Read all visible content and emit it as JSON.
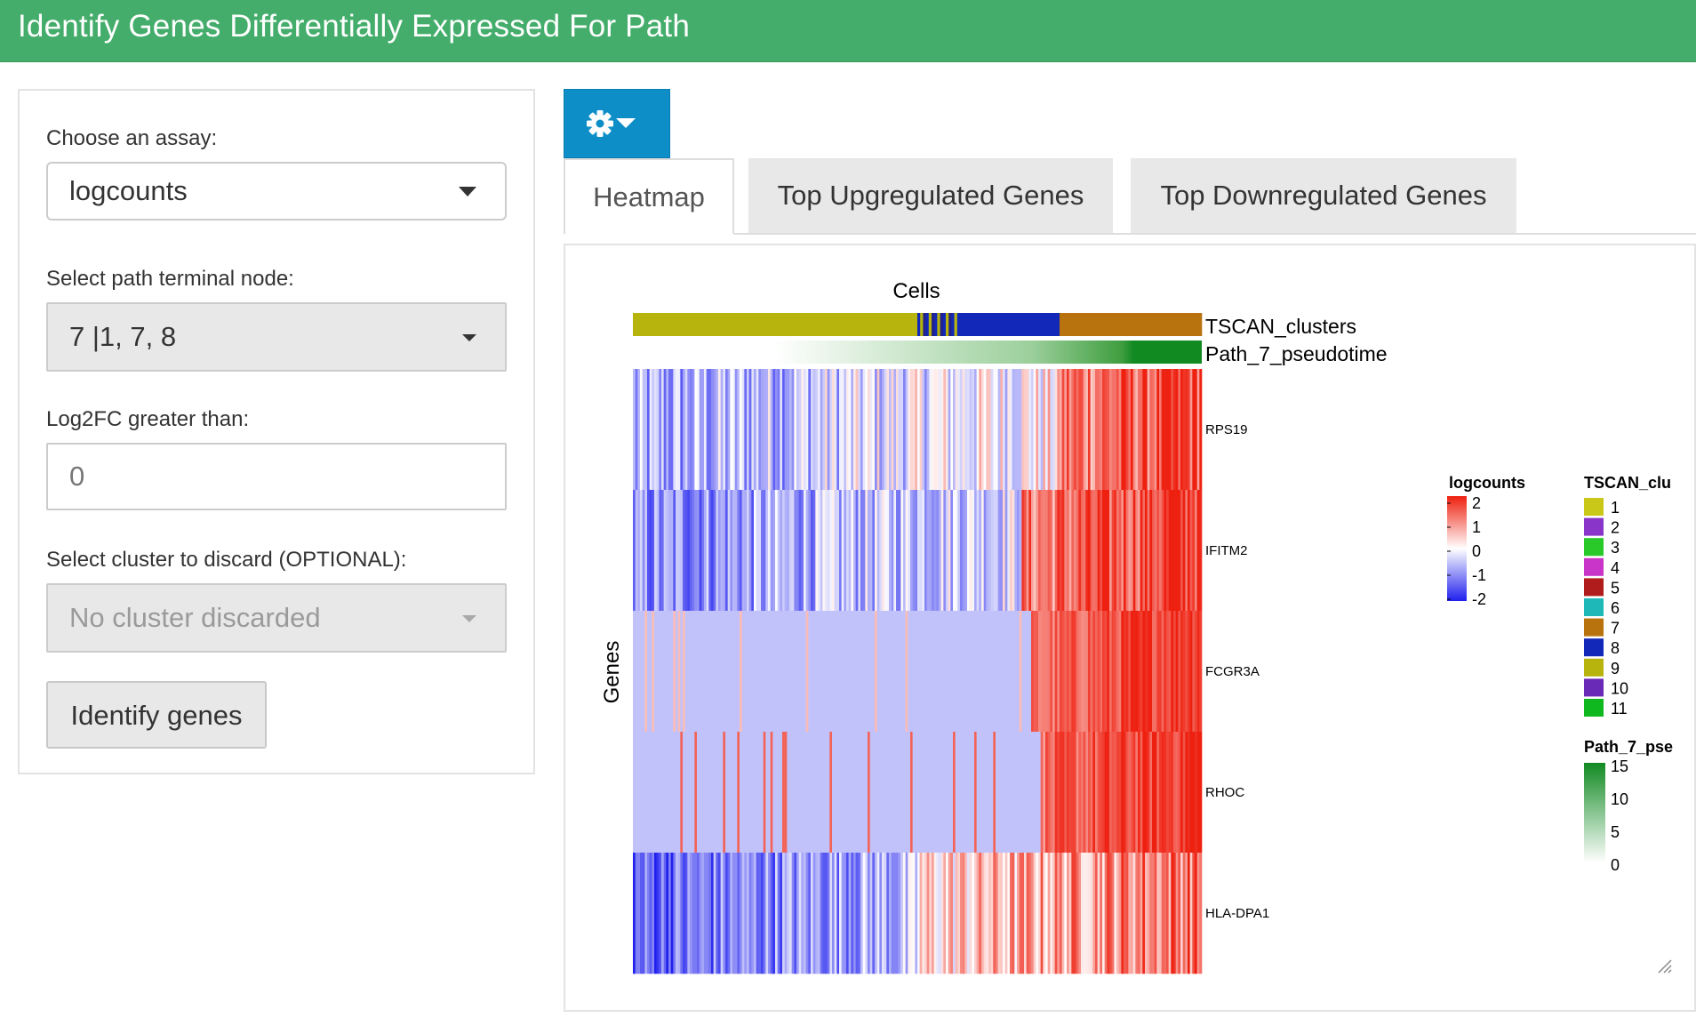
{
  "header": {
    "title": "Identify Genes Differentially Expressed For Path"
  },
  "sidebar": {
    "assay_label": "Choose an assay:",
    "assay_value": "logcounts",
    "terminal_node_label": "Select path terminal node:",
    "terminal_node_value": "7 |1, 7, 8",
    "log2fc_label": "Log2FC greater than:",
    "log2fc_value": "0",
    "discard_label": "Select cluster to discard (OPTIONAL):",
    "discard_value": "No cluster discarded",
    "identify_button": "Identify genes"
  },
  "toolbar": {
    "gear_icon": "gear-icon",
    "dropdown_icon": "caret-down-icon",
    "color": "#0d8ec7"
  },
  "tabs": [
    {
      "label": "Heatmap",
      "active": true
    },
    {
      "label": "Top Upgregulated Genes",
      "active": false
    },
    {
      "label": "Top Downregulated Genes",
      "active": false
    }
  ],
  "chart_data": {
    "type": "heatmap",
    "title": "Cells",
    "ylabel": "Genes",
    "rows": [
      "RPS19",
      "IFITM2",
      "FCGR3A",
      "RHOC",
      "HLA-DPA1"
    ],
    "annotations": [
      {
        "name": "TSCAN_clusters",
        "type": "categorical",
        "segments": [
          {
            "cluster": "9",
            "fraction": 0.5
          },
          {
            "cluster": "mixed",
            "fraction": 0.07
          },
          {
            "cluster": "8",
            "fraction": 0.18
          },
          {
            "cluster": "7",
            "fraction": 0.25
          }
        ]
      },
      {
        "name": "Path_7_pseudotime",
        "type": "continuous",
        "range": [
          0,
          15
        ]
      }
    ],
    "color_scale": {
      "name": "logcounts",
      "ticks": [
        "2",
        "1",
        "0",
        "-1",
        "-2"
      ],
      "range": [
        -2,
        2
      ],
      "low": "#2020ee",
      "mid": "#ffffff",
      "high": "#ee2010"
    },
    "cluster_legend": {
      "title": "TSCAN_clu",
      "items": [
        {
          "label": "1",
          "color": "#c9c718"
        },
        {
          "label": "2",
          "color": "#8a35c9"
        },
        {
          "label": "3",
          "color": "#28c928"
        },
        {
          "label": "4",
          "color": "#c935c9"
        },
        {
          "label": "5",
          "color": "#b01c1c"
        },
        {
          "label": "6",
          "color": "#1fb8b8"
        },
        {
          "label": "7",
          "color": "#b8730e"
        },
        {
          "label": "8",
          "color": "#1228b8"
        },
        {
          "label": "9",
          "color": "#b8b40e"
        },
        {
          "label": "10",
          "color": "#6a2ab8"
        },
        {
          "label": "11",
          "color": "#10b820"
        }
      ]
    },
    "pseudotime_legend": {
      "title": "Path_7_pse",
      "ticks": [
        "15",
        "10",
        "5",
        "0"
      ],
      "range": [
        0,
        15
      ],
      "color": "#118a22"
    }
  }
}
